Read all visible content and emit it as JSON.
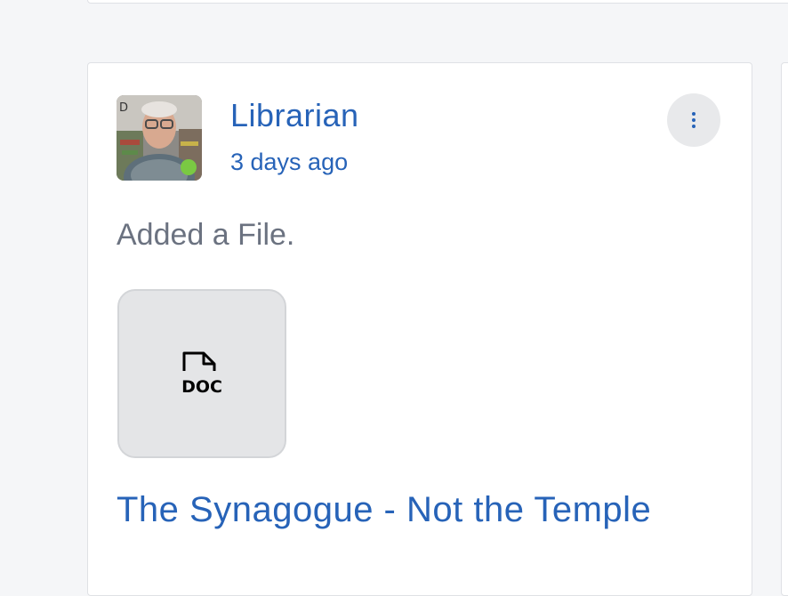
{
  "activity": {
    "author": "Librarian",
    "time_ago": "3 days ago",
    "action_text": "Added a File.",
    "file": {
      "type_label": "DOC",
      "icon": "doc-file-icon",
      "title": "The Synagogue - Not the Temple"
    },
    "more_icon": "vertical-ellipsis-icon",
    "status_icon": "online-status-dot",
    "colors": {
      "link": "#2763b8",
      "muted_text": "#6b7280",
      "online": "#7ac943",
      "thumb_bg": "#e4e5e7"
    }
  }
}
